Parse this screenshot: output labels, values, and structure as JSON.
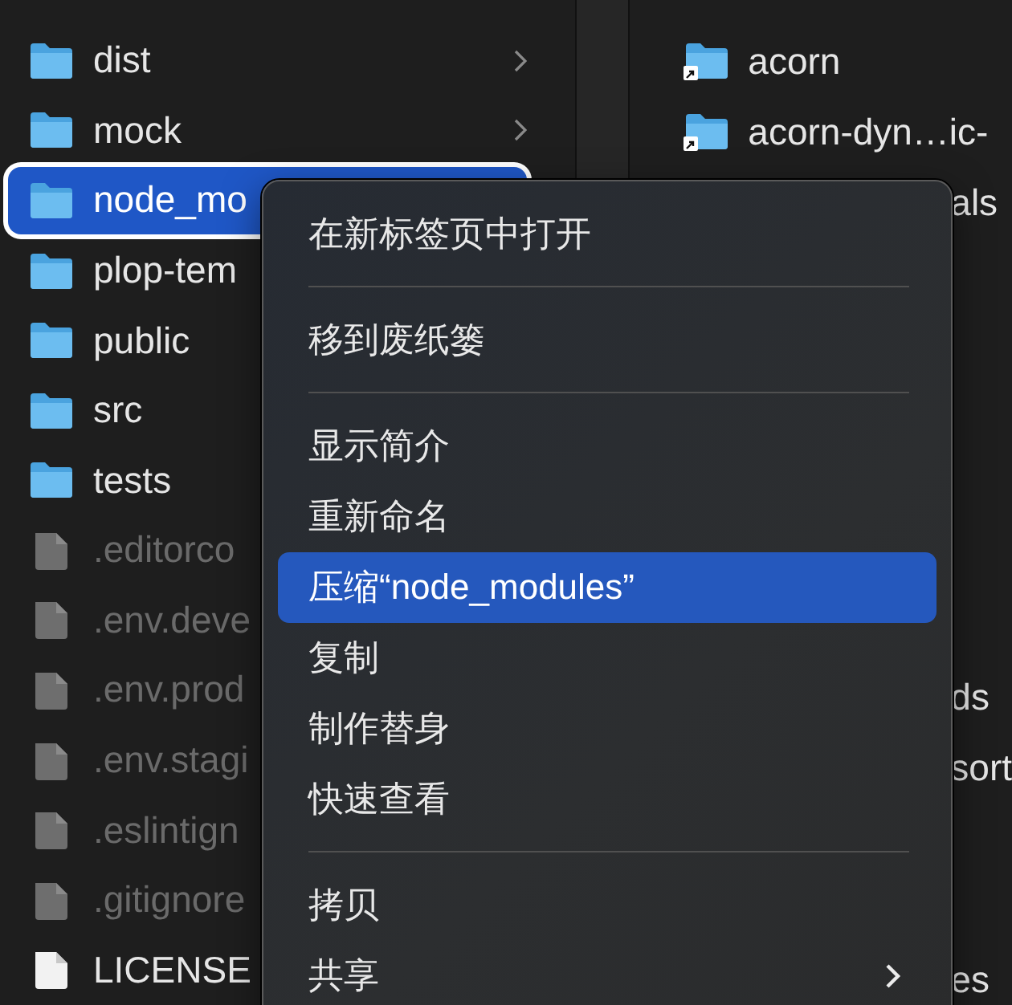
{
  "left_column": [
    {
      "kind": "folder",
      "name": "dist",
      "chevron": true,
      "dimmed": false,
      "selected": false
    },
    {
      "kind": "folder",
      "name": "mock",
      "chevron": true,
      "dimmed": false,
      "selected": false
    },
    {
      "kind": "folder",
      "name": "node_mo",
      "chevron": false,
      "dimmed": false,
      "selected": true
    },
    {
      "kind": "folder",
      "name": "plop-tem",
      "chevron": false,
      "dimmed": false,
      "selected": false
    },
    {
      "kind": "folder",
      "name": "public",
      "chevron": false,
      "dimmed": false,
      "selected": false
    },
    {
      "kind": "folder",
      "name": "src",
      "chevron": false,
      "dimmed": false,
      "selected": false
    },
    {
      "kind": "folder",
      "name": "tests",
      "chevron": false,
      "dimmed": false,
      "selected": false
    },
    {
      "kind": "file",
      "name": ".editorco",
      "chevron": false,
      "dimmed": true,
      "selected": false
    },
    {
      "kind": "file",
      "name": ".env.deve",
      "chevron": false,
      "dimmed": true,
      "selected": false
    },
    {
      "kind": "file",
      "name": ".env.prod",
      "chevron": false,
      "dimmed": true,
      "selected": false
    },
    {
      "kind": "file",
      "name": ".env.stagi",
      "chevron": false,
      "dimmed": true,
      "selected": false
    },
    {
      "kind": "file",
      "name": ".eslintign",
      "chevron": false,
      "dimmed": true,
      "selected": false
    },
    {
      "kind": "file",
      "name": ".gitignore",
      "chevron": false,
      "dimmed": true,
      "selected": false
    },
    {
      "kind": "file",
      "name": "LICENSE",
      "chevron": false,
      "dimmed": false,
      "selected": false
    }
  ],
  "right_column": {
    "top": [
      {
        "kind": "alias",
        "name": "acorn"
      },
      {
        "kind": "alias",
        "name": "acorn-dyn…ic-"
      },
      {
        "kind": "covered",
        "name": "als"
      }
    ],
    "middle": [
      {
        "kind": "covered",
        "name": "ds"
      },
      {
        "kind": "covered",
        "name": "sort"
      }
    ],
    "bottom": [
      {
        "kind": "covered",
        "name": "es"
      }
    ]
  },
  "context_menu": [
    {
      "kind": "item",
      "label": "在新标签页中打开",
      "selected": false,
      "submenu": false
    },
    {
      "kind": "separator"
    },
    {
      "kind": "item",
      "label": "移到废纸篓",
      "selected": false,
      "submenu": false
    },
    {
      "kind": "separator"
    },
    {
      "kind": "item",
      "label": "显示简介",
      "selected": false,
      "submenu": false
    },
    {
      "kind": "item",
      "label": "重新命名",
      "selected": false,
      "submenu": false
    },
    {
      "kind": "item",
      "label": "压缩“node_modules”",
      "selected": true,
      "submenu": false
    },
    {
      "kind": "item",
      "label": "复制",
      "selected": false,
      "submenu": false
    },
    {
      "kind": "item",
      "label": "制作替身",
      "selected": false,
      "submenu": false
    },
    {
      "kind": "item",
      "label": "快速查看",
      "selected": false,
      "submenu": false
    },
    {
      "kind": "separator"
    },
    {
      "kind": "item",
      "label": "拷贝",
      "selected": false,
      "submenu": false
    },
    {
      "kind": "item",
      "label": "共享",
      "selected": false,
      "submenu": true
    }
  ]
}
